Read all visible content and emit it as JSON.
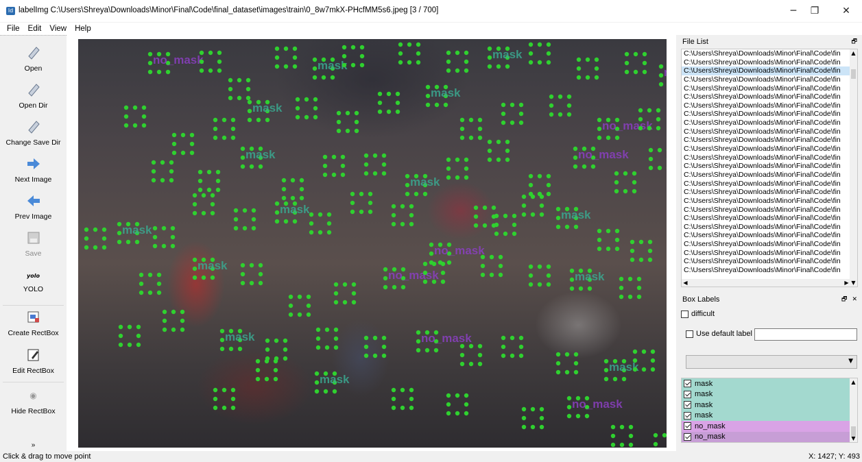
{
  "window": {
    "title": "labelImg C:\\Users\\Shreya\\Downloads\\Minor\\Final\\Code\\final_dataset\\images\\train\\0_8w7mkX-PHcfMM5s6.jpeg [3 / 700]",
    "app_icon_text": "ld",
    "minimize": "─",
    "restore": "❐",
    "close": "✕"
  },
  "menu": [
    "File",
    "Edit",
    "View",
    "Help"
  ],
  "toolbar": {
    "open": "Open",
    "open_dir": "Open Dir",
    "change_save_dir": "Change Save Dir",
    "next_image": "Next Image",
    "prev_image": "Prev Image",
    "save": "Save",
    "yolo_icon_text": "yolo",
    "yolo": "YOLO",
    "create_rectbox": "Create RectBox",
    "edit_rectbox": "Edit RectBox",
    "hide_rectbox": "Hide RectBox",
    "more": "»"
  },
  "file_list": {
    "title": "File List",
    "float_icon": "float-icon",
    "items": [
      "C:\\Users\\Shreya\\Downloads\\Minor\\Final\\Code\\fin",
      "C:\\Users\\Shreya\\Downloads\\Minor\\Final\\Code\\fin",
      "C:\\Users\\Shreya\\Downloads\\Minor\\Final\\Code\\fin",
      "C:\\Users\\Shreya\\Downloads\\Minor\\Final\\Code\\fin",
      "C:\\Users\\Shreya\\Downloads\\Minor\\Final\\Code\\fin",
      "C:\\Users\\Shreya\\Downloads\\Minor\\Final\\Code\\fin",
      "C:\\Users\\Shreya\\Downloads\\Minor\\Final\\Code\\fin",
      "C:\\Users\\Shreya\\Downloads\\Minor\\Final\\Code\\fin",
      "C:\\Users\\Shreya\\Downloads\\Minor\\Final\\Code\\fin",
      "C:\\Users\\Shreya\\Downloads\\Minor\\Final\\Code\\fin",
      "C:\\Users\\Shreya\\Downloads\\Minor\\Final\\Code\\fin",
      "C:\\Users\\Shreya\\Downloads\\Minor\\Final\\Code\\fin",
      "C:\\Users\\Shreya\\Downloads\\Minor\\Final\\Code\\fin",
      "C:\\Users\\Shreya\\Downloads\\Minor\\Final\\Code\\fin",
      "C:\\Users\\Shreya\\Downloads\\Minor\\Final\\Code\\fin",
      "C:\\Users\\Shreya\\Downloads\\Minor\\Final\\Code\\fin",
      "C:\\Users\\Shreya\\Downloads\\Minor\\Final\\Code\\fin",
      "C:\\Users\\Shreya\\Downloads\\Minor\\Final\\Code\\fin",
      "C:\\Users\\Shreya\\Downloads\\Minor\\Final\\Code\\fin",
      "C:\\Users\\Shreya\\Downloads\\Minor\\Final\\Code\\fin",
      "C:\\Users\\Shreya\\Downloads\\Minor\\Final\\Code\\fin",
      "C:\\Users\\Shreya\\Downloads\\Minor\\Final\\Code\\fin",
      "C:\\Users\\Shreya\\Downloads\\Minor\\Final\\Code\\fin",
      "C:\\Users\\Shreya\\Downloads\\Minor\\Final\\Code\\fin",
      "C:\\Users\\Shreya\\Downloads\\Minor\\Final\\Code\\fin",
      "C:\\Users\\Shreya\\Downloads\\Minor\\Final\\Code\\fin"
    ],
    "selected_index": 2
  },
  "box_labels": {
    "title": "Box Labels",
    "float_icon": "🗗",
    "close_icon": "✕",
    "difficult": "difficult",
    "use_default_label": "Use default label",
    "default_label_value": "",
    "combo_value": "",
    "labels": [
      {
        "name": "mask",
        "checked": true,
        "color": "#a3d9cf"
      },
      {
        "name": "mask",
        "checked": true,
        "color": "#a3d9cf"
      },
      {
        "name": "mask",
        "checked": true,
        "color": "#a3d9cf"
      },
      {
        "name": "mask",
        "checked": true,
        "color": "#a3d9cf"
      },
      {
        "name": "no_mask",
        "checked": true,
        "color": "#d9a3e6"
      },
      {
        "name": "no_mask",
        "checked": true,
        "color": "#c79ed6"
      }
    ]
  },
  "canvas_labels": {
    "mask": "mask",
    "no_mask": "no_mask"
  },
  "colors": {
    "mask_text": "#3aa890",
    "no_mask_text": "#8a3fc0",
    "point": "#2fd12f"
  },
  "status": {
    "message": "Click & drag to move point",
    "coords": "X: 1427; Y: 493"
  }
}
